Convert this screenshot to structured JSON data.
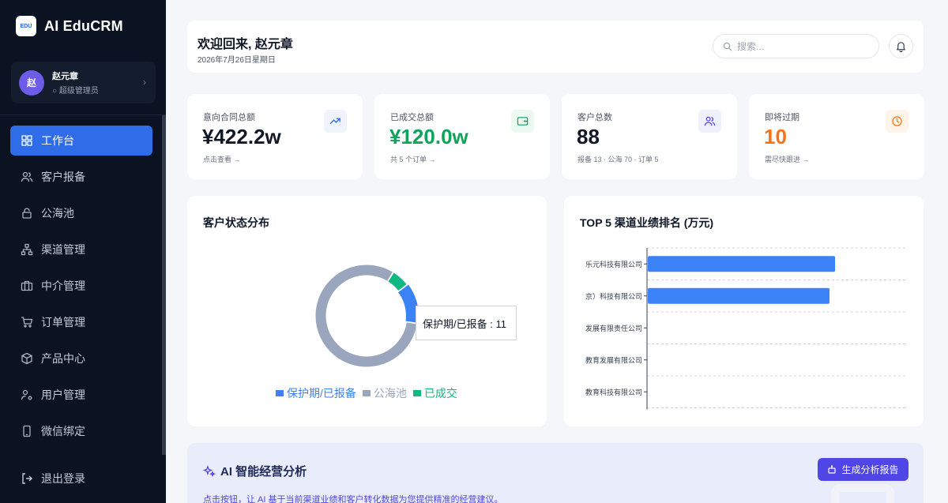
{
  "app": {
    "name": "AI EduCRM",
    "logo_text": "EDU"
  },
  "user": {
    "avatar": "赵",
    "name": "赵元章",
    "role": "超级管理员"
  },
  "nav": [
    {
      "label": "工作台",
      "icon": "dashboard-icon",
      "active": true
    },
    {
      "label": "客户报备",
      "icon": "users-icon"
    },
    {
      "label": "公海池",
      "icon": "lock-icon"
    },
    {
      "label": "渠道管理",
      "icon": "network-icon"
    },
    {
      "label": "中介管理",
      "icon": "briefcase-icon"
    },
    {
      "label": "订单管理",
      "icon": "cart-icon"
    },
    {
      "label": "产品中心",
      "icon": "box-icon"
    },
    {
      "label": "用户管理",
      "icon": "user-key-icon"
    },
    {
      "label": "微信绑定",
      "icon": "phone-icon"
    }
  ],
  "logout_label": "退出登录",
  "header": {
    "greeting": "欢迎回来, 赵元章",
    "date": "2026年7月26日星期日",
    "search_placeholder": "搜索..."
  },
  "stats": [
    {
      "label": "意向合同总额",
      "value": "¥422.2w",
      "sub": "点击查看 →",
      "value_color": "#111827",
      "icon": "trend-up-icon",
      "icon_bg": "#eef3fe",
      "icon_color": "#2563eb"
    },
    {
      "label": "已成交总额",
      "value": "¥120.0w",
      "sub": "共 5 个订单 →",
      "value_color": "#10a35a",
      "icon": "wallet-icon",
      "icon_bg": "#eafaf1",
      "icon_color": "#10a35a"
    },
    {
      "label": "客户总数",
      "value": "88",
      "sub": "报备 13 · 公海 70 · 订单 5",
      "value_color": "#111827",
      "icon": "users-icon",
      "icon_bg": "#eef0fd",
      "icon_color": "#4f46e5"
    },
    {
      "label": "即将过期",
      "value": "10",
      "sub": "需尽快跟进 →",
      "value_color": "#f97316",
      "icon": "clock-icon",
      "icon_bg": "#fff4ea",
      "icon_color": "#f97316"
    }
  ],
  "status_panel": {
    "title": "客户状态分布",
    "tooltip": "保护期/已报备 : 11"
  },
  "ranking_panel": {
    "title": "TOP 5 渠道业绩排名 (万元)"
  },
  "chart_data": [
    {
      "type": "pie",
      "title": "客户状态分布",
      "donut": true,
      "categories": [
        "保护期/已报备",
        "公海池",
        "已成交"
      ],
      "values": [
        11,
        70,
        5
      ],
      "colors": [
        "#3b82f6",
        "#9aa6bd",
        "#10b981"
      ],
      "legend_position": "bottom"
    },
    {
      "type": "bar",
      "orientation": "horizontal",
      "title": "TOP 5 渠道业绩排名 (万元)",
      "categories": [
        "乐元科技有限公司",
        "京）科技有限公司",
        "发展有限责任公司",
        "教育发展有限公司",
        "教育科技有限公司"
      ],
      "values": [
        100,
        97,
        0,
        0,
        0
      ],
      "xlim": [
        0,
        120
      ],
      "bar_color": "#3b82f6",
      "grid": true
    }
  ],
  "ai": {
    "title": "AI 智能经营分析",
    "button": "生成分析报告",
    "description": "点击按钮，让 AI 基于当前渠道业绩和客户转化数据为您提供精准的经营建议。"
  }
}
